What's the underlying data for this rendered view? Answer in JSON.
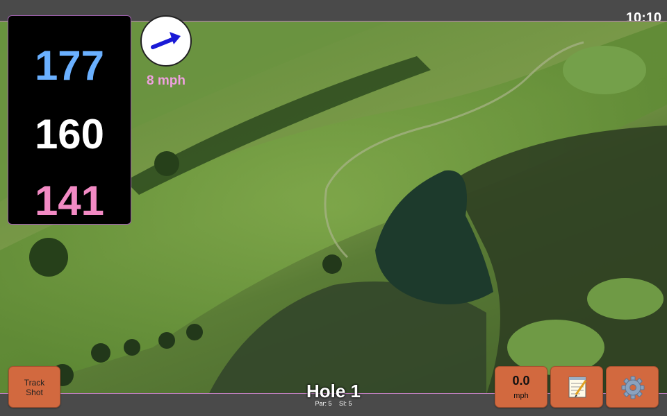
{
  "status_bar": {
    "time": "10:10"
  },
  "distances": {
    "back": "177",
    "middle": "160",
    "front": "141"
  },
  "wind": {
    "speed_label": "8 mph",
    "arrow_icon": "wind-arrow-icon",
    "arrow_color": "#1a1ad6"
  },
  "buttons": {
    "track_shot": "Track\nShot",
    "wind_value": "0.0",
    "wind_unit": "mph",
    "notes_icon": "notepad-icon",
    "settings_icon": "gear-icon"
  },
  "hole": {
    "title": "Hole 1",
    "par": "Par: 5",
    "si": "SI: 5"
  },
  "colors": {
    "back_distance": "#6ab0ff",
    "middle_distance": "#ffffff",
    "front_distance": "#f28ac4",
    "button": "#d2693f",
    "wind_text": "#f0a0e0"
  }
}
